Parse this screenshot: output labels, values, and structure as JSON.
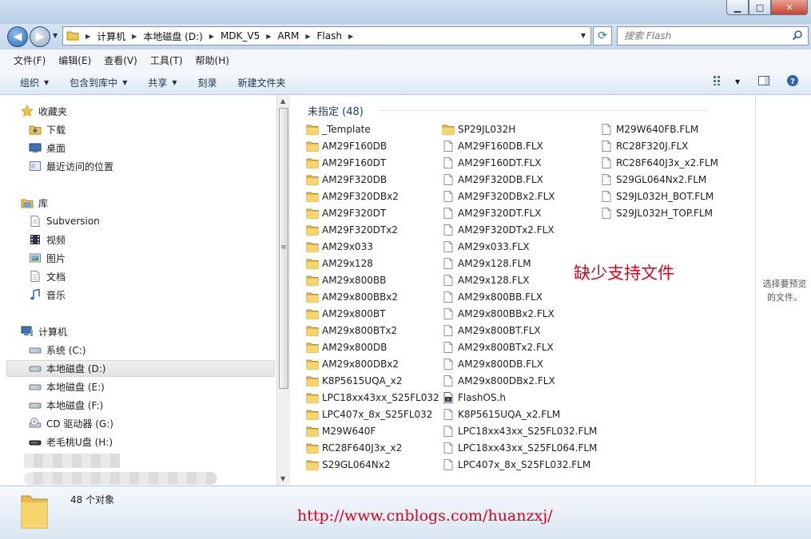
{
  "window": {
    "minimize_glyph": "▁",
    "maximize_glyph": "□",
    "close_glyph": "✕"
  },
  "address": {
    "crumbs": [
      "计算机",
      "本地磁盘 (D:)",
      "MDK_V5",
      "ARM",
      "Flash"
    ]
  },
  "search": {
    "placeholder": "搜索 Flash"
  },
  "menu": [
    "文件(F)",
    "编辑(E)",
    "查看(V)",
    "工具(T)",
    "帮助(H)"
  ],
  "toolbar": {
    "organize": "组织",
    "include_in_library": "包含到库中",
    "share": "共享",
    "burn": "刻录",
    "new_folder": "新建文件夹"
  },
  "sidebar": {
    "favorites": "收藏夹",
    "downloads": "下载",
    "desktop": "桌面",
    "recent": "最近访问的位置",
    "libraries": "库",
    "subversion": "Subversion",
    "videos": "视频",
    "pictures": "图片",
    "documents": "文档",
    "music": "音乐",
    "computer": "计算机",
    "drive_c": "系统 (C:)",
    "drive_d": "本地磁盘 (D:)",
    "drive_e": "本地磁盘 (E:)",
    "drive_f": "本地磁盘 (F:)",
    "drive_g": "CD 驱动器 (G:)",
    "drive_h": "老毛桃U盘 (H:)"
  },
  "group_header": "未指定 (48)",
  "files": {
    "col1": [
      {
        "name": "_Template",
        "type": "folder"
      },
      {
        "name": "AM29F160DB",
        "type": "folder"
      },
      {
        "name": "AM29F160DT",
        "type": "folder"
      },
      {
        "name": "AM29F320DB",
        "type": "folder"
      },
      {
        "name": "AM29F320DBx2",
        "type": "folder"
      },
      {
        "name": "AM29F320DT",
        "type": "folder"
      },
      {
        "name": "AM29F320DTx2",
        "type": "folder"
      },
      {
        "name": "AM29x033",
        "type": "folder"
      },
      {
        "name": "AM29x128",
        "type": "folder"
      },
      {
        "name": "AM29x800BB",
        "type": "folder"
      },
      {
        "name": "AM29x800BBx2",
        "type": "folder"
      },
      {
        "name": "AM29x800BT",
        "type": "folder"
      },
      {
        "name": "AM29x800BTx2",
        "type": "folder"
      },
      {
        "name": "AM29x800DB",
        "type": "folder"
      },
      {
        "name": "AM29x800DBx2",
        "type": "folder"
      },
      {
        "name": "K8P5615UQA_x2",
        "type": "folder"
      },
      {
        "name": "LPC18xx43xx_S25FL032",
        "type": "folder"
      },
      {
        "name": "LPC407x_8x_S25FL032",
        "type": "folder"
      },
      {
        "name": "M29W640F",
        "type": "folder"
      },
      {
        "name": "RC28F640J3x_x2",
        "type": "folder"
      },
      {
        "name": "S29GL064Nx2",
        "type": "folder"
      }
    ],
    "col2": [
      {
        "name": "SP29JL032H",
        "type": "folder"
      },
      {
        "name": "AM29F160DB.FLX",
        "type": "file"
      },
      {
        "name": "AM29F160DT.FLX",
        "type": "file"
      },
      {
        "name": "AM29F320DB.FLX",
        "type": "file"
      },
      {
        "name": "AM29F320DBx2.FLX",
        "type": "file"
      },
      {
        "name": "AM29F320DT.FLX",
        "type": "file"
      },
      {
        "name": "AM29F320DTx2.FLX",
        "type": "file"
      },
      {
        "name": "AM29x033.FLX",
        "type": "file"
      },
      {
        "name": "AM29x128.FLM",
        "type": "file"
      },
      {
        "name": "AM29x128.FLX",
        "type": "file"
      },
      {
        "name": "AM29x800BB.FLX",
        "type": "file"
      },
      {
        "name": "AM29x800BBx2.FLX",
        "type": "file"
      },
      {
        "name": "AM29x800BT.FLX",
        "type": "file"
      },
      {
        "name": "AM29x800BTx2.FLX",
        "type": "file"
      },
      {
        "name": "AM29x800DB.FLX",
        "type": "file"
      },
      {
        "name": "AM29x800DBx2.FLX",
        "type": "file"
      },
      {
        "name": "FlashOS.h",
        "type": "header"
      },
      {
        "name": "K8P5615UQA_x2.FLM",
        "type": "file"
      },
      {
        "name": "LPC18xx43xx_S25FL032.FLM",
        "type": "file"
      },
      {
        "name": "LPC18xx43xx_S25FL064.FLM",
        "type": "file"
      },
      {
        "name": "LPC407x_8x_S25FL032.FLM",
        "type": "file"
      }
    ],
    "col3": [
      {
        "name": "M29W640FB.FLM",
        "type": "file"
      },
      {
        "name": "RC28F320J.FLX",
        "type": "file"
      },
      {
        "name": "RC28F640J3x_x2.FLM",
        "type": "file"
      },
      {
        "name": "S29GL064Nx2.FLM",
        "type": "file"
      },
      {
        "name": "S29JL032H_BOT.FLM",
        "type": "file"
      },
      {
        "name": "S29JL032H_TOP.FLM",
        "type": "file"
      }
    ]
  },
  "annotation": "缺少支持文件",
  "preview_text": "选择要预览的文件。",
  "status": {
    "count": "48 个对象"
  },
  "watermark": "http://www.cnblogs.com/huanzxj/",
  "colors": {
    "annotation_red": "#e0001b",
    "folder_yellow": "#f3c64a",
    "header_blue": "#1e395b"
  }
}
